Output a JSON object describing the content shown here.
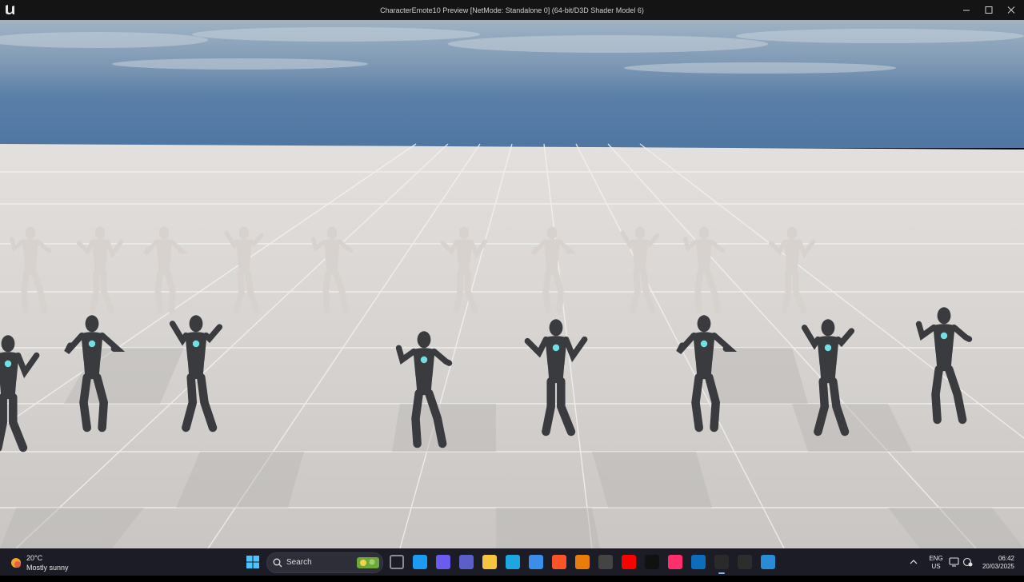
{
  "window": {
    "title": "CharacterEmote10 Preview [NetMode: Standalone 0]  (64-bit/D3D Shader Model 6)",
    "app_icon": "unreal-engine-logo",
    "controls": [
      "minimize-icon",
      "maximize-icon",
      "close-icon"
    ]
  },
  "viewport": {
    "scene": "3d-character-emote-preview",
    "sky_color": "#5a7fa8",
    "floor_color": "#cfcbc8",
    "back_row_mannequin_color": "#d8d2ce",
    "front_row_mannequin_color": "#3a3b3f",
    "chest_emblem_color": "#6ee0e6"
  },
  "taskbar": {
    "weather": {
      "temperature": "20°C",
      "condition": "Mostly sunny"
    },
    "search": {
      "label": "Search"
    },
    "apps": [
      {
        "name": "task-view-icon",
        "color": "#8b8b95"
      },
      {
        "name": "twitter-icon",
        "color": "#1d9bf0"
      },
      {
        "name": "copilot-icon",
        "color": "#6b5cf0"
      },
      {
        "name": "teams-icon",
        "color": "#5b5fc7"
      },
      {
        "name": "file-explorer-icon",
        "color": "#f5c542"
      },
      {
        "name": "edge-icon",
        "color": "#1fa6e0"
      },
      {
        "name": "store-icon",
        "color": "#3b8ee8"
      },
      {
        "name": "brave-icon",
        "color": "#fb542b"
      },
      {
        "name": "blender-icon",
        "color": "#e87d0d"
      },
      {
        "name": "github-icon",
        "color": "#444444"
      },
      {
        "name": "youtube-icon",
        "color": "#ff0000"
      },
      {
        "name": "tiktok-icon",
        "color": "#111111"
      },
      {
        "name": "capcut-icon",
        "color": "#ff2f6e"
      },
      {
        "name": "outlook-icon",
        "color": "#0f6cbd"
      },
      {
        "name": "unreal-engine-icon",
        "color": "#2a2a2a"
      },
      {
        "name": "epic-games-icon",
        "color": "#2d2d2d"
      },
      {
        "name": "photos-icon",
        "color": "#2a8bd6"
      }
    ],
    "tray": {
      "language": "ENG",
      "region": "US",
      "time": "06:42",
      "date": "20/03/2025"
    }
  }
}
